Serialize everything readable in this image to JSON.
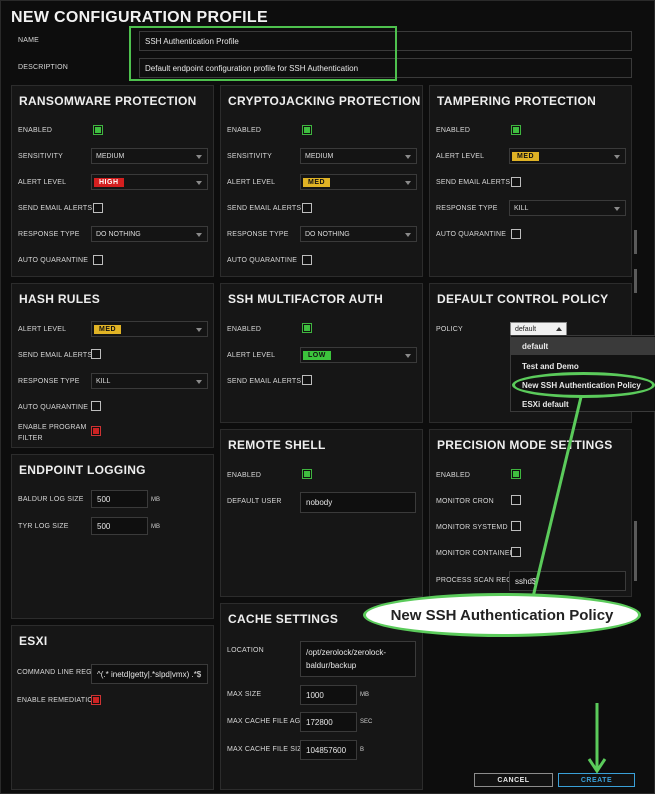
{
  "title": "NEW CONFIGURATION PROFILE",
  "name_label": "NAME",
  "name_value": "SSH Authentication Profile",
  "description_label": "DESCRIPTION",
  "description_value": "Default endpoint configuration profile  for SSH Authentication",
  "ransomware": {
    "title": "RANSOMWARE PROTECTION",
    "enabled": "ENABLED",
    "sensitivity": "SENSITIVITY",
    "sensitivity_value": "MEDIUM",
    "alert_level": "ALERT LEVEL",
    "alert_value": "HIGH",
    "send_email": "SEND EMAIL ALERTS",
    "response_type": "RESPONSE TYPE",
    "response_value": "DO NOTHING",
    "auto_quarantine": "AUTO QUARANTINE"
  },
  "crypto": {
    "title": "CRYPTOJACKING PROTECTION",
    "enabled": "ENABLED",
    "sensitivity": "SENSITIVITY",
    "sensitivity_value": "MEDIUM",
    "alert_level": "ALERT LEVEL",
    "alert_value": "MED",
    "send_email": "SEND EMAIL ALERTS",
    "response_type": "RESPONSE TYPE",
    "response_value": "DO NOTHING",
    "auto_quarantine": "AUTO QUARANTINE"
  },
  "tampering": {
    "title": "TAMPERING PROTECTION",
    "enabled": "ENABLED",
    "alert_level": "ALERT LEVEL",
    "alert_value": "MED",
    "send_email": "SEND EMAIL ALERTS",
    "response_type": "RESPONSE TYPE",
    "response_value": "KILL",
    "auto_quarantine": "AUTO QUARANTINE"
  },
  "hash": {
    "title": "HASH RULES",
    "alert_level": "ALERT LEVEL",
    "alert_value": "MED",
    "send_email": "SEND EMAIL ALERTS",
    "response_type": "RESPONSE TYPE",
    "response_value": "KILL",
    "auto_quarantine": "AUTO QUARANTINE",
    "enable_filter_1": "ENABLE PROGRAM",
    "enable_filter_2": "FILTER"
  },
  "ssh_mfa": {
    "title": "SSH MULTIFACTOR AUTH",
    "enabled": "ENABLED",
    "alert_level": "ALERT LEVEL",
    "alert_value": "LOW",
    "send_email": "SEND EMAIL ALERTS"
  },
  "policy": {
    "title": "DEFAULT CONTROL POLICY",
    "label": "POLICY",
    "value": "default",
    "options": [
      "default",
      "Test and Demo",
      "New SSH Authentication Policy",
      "ESXi default"
    ]
  },
  "endpoint_logging": {
    "title": "ENDPOINT LOGGING",
    "baldur_label": "BALDUR LOG SIZE",
    "baldur_value": "500",
    "tyr_label": "TYR LOG SIZE",
    "tyr_value": "500",
    "unit": "MB"
  },
  "remote_shell": {
    "title": "REMOTE SHELL",
    "enabled": "ENABLED",
    "default_user": "DEFAULT USER",
    "default_user_value": "nobody"
  },
  "precision": {
    "title": "PRECISION MODE SETTINGS",
    "enabled": "ENABLED",
    "monitor_cron": "MONITOR CRON",
    "monitor_systemd": "MONITOR SYSTEMD",
    "monitor_containerd": "MONITOR CONTAINERD",
    "scan_regex": "PROCESS SCAN REGEX",
    "scan_regex_value": "sshd$"
  },
  "cache": {
    "title": "CACHE SETTINGS",
    "location": "LOCATION",
    "location_value_1": "/opt/zerolock/zerolock-",
    "location_value_2": "baldur/backup",
    "max_size": "MAX SIZE",
    "max_size_value": "1000",
    "max_size_unit": "MB",
    "max_age": "MAX CACHE FILE AGE",
    "max_age_value": "172800",
    "max_age_unit": "SEC",
    "max_file_size": "MAX CACHE FILE SIZE",
    "max_file_size_value": "104857600",
    "max_file_size_unit": "B"
  },
  "esxi": {
    "title": "ESXI",
    "cmd_label": "COMMAND LINE REGEX",
    "cmd_value": "^(.* inetd|getty|.*slpd|vmx) .*$",
    "remediation": "ENABLE REMEDIATION"
  },
  "callout_text": "New SSH Authentication Policy",
  "cancel_label": "CANCEL",
  "create_label": "CREATE",
  "colors": {
    "highlight_green": "#4ec14e",
    "high": "#d31f1f",
    "med": "#e0b325",
    "low": "#3cc43c",
    "create_blue": "#3aa0d8"
  }
}
